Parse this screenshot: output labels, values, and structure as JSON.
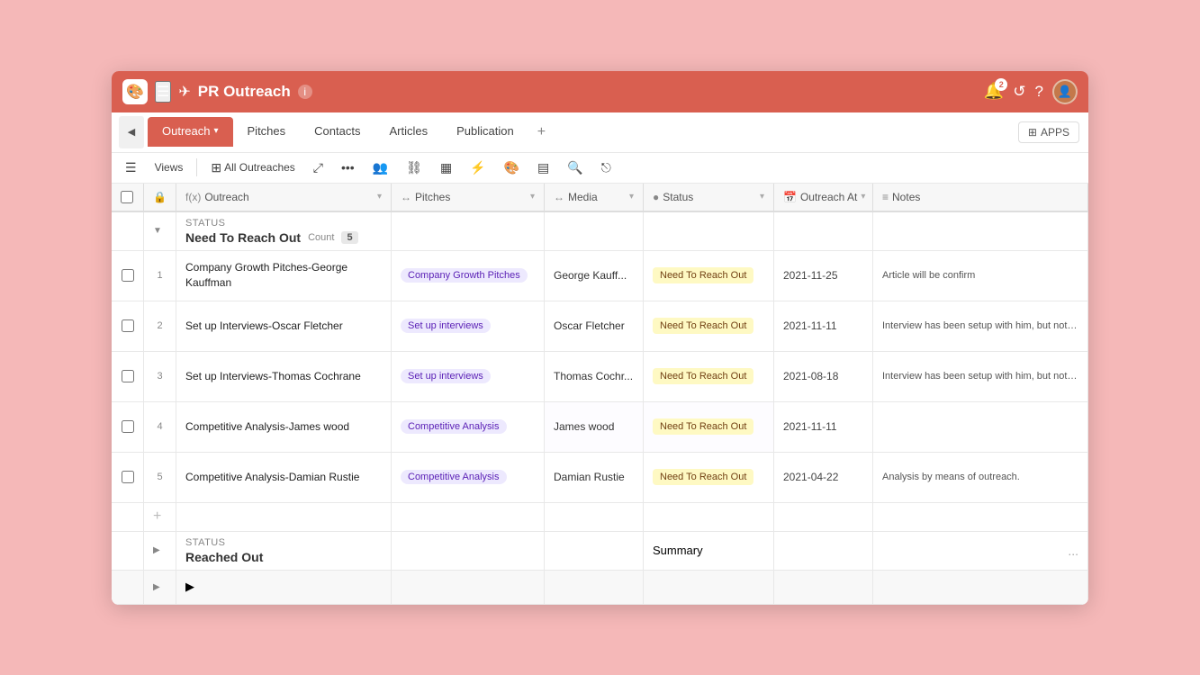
{
  "app": {
    "logo_emoji": "🎨",
    "title": "PR Outreach",
    "info_label": "ℹ",
    "notif_count": "2",
    "avatar_emoji": "👤"
  },
  "tabs": [
    {
      "id": "outreach",
      "label": "Outreach",
      "active": true
    },
    {
      "id": "pitches",
      "label": "Pitches",
      "active": false
    },
    {
      "id": "contacts",
      "label": "Contacts",
      "active": false
    },
    {
      "id": "articles",
      "label": "Articles",
      "active": false
    },
    {
      "id": "publication",
      "label": "Publication",
      "active": false
    }
  ],
  "toolbar": {
    "views_label": "Views",
    "alloutreaches_label": "All Outreaches"
  },
  "columns": [
    {
      "id": "outreach",
      "label": "Outreach",
      "icon": "fx"
    },
    {
      "id": "pitches",
      "label": "Pitches",
      "icon": "↔"
    },
    {
      "id": "media",
      "label": "Media",
      "icon": "↔"
    },
    {
      "id": "status",
      "label": "Status",
      "icon": "●"
    },
    {
      "id": "outreach_at",
      "label": "Outreach At",
      "icon": "📅"
    },
    {
      "id": "notes",
      "label": "Notes",
      "icon": "≡"
    }
  ],
  "groups": [
    {
      "id": "need-to-reach-out",
      "status_label": "STATUS",
      "title": "Need To Reach Out",
      "count_label": "Count",
      "count": "5",
      "rows": [
        {
          "num": "1",
          "outreach": "Company Growth Pitches-George Kauffman",
          "pitches": "Company Growth Pitches",
          "media": "George Kauff...",
          "status": "Need To Reach Out",
          "date": "2021-11-25",
          "notes": "Article will be confirm"
        },
        {
          "num": "2",
          "outreach": "Set up Interviews-Oscar Fletcher",
          "pitches": "Set up interviews",
          "media": "Oscar Fletcher",
          "status": "Need To Reach Out",
          "date": "2021-11-11",
          "notes": "Interview has been setup with him, but not a..."
        },
        {
          "num": "3",
          "outreach": "Set up Interviews-Thomas Cochrane",
          "pitches": "Set up interviews",
          "media": "Thomas Cochr...",
          "status": "Need To Reach Out",
          "date": "2021-08-18",
          "notes": "Interview has been setup with him, but not a..."
        },
        {
          "num": "4",
          "outreach": "Competitive Analysis-James wood",
          "pitches": "Competitive Analysis",
          "media": "James wood",
          "status": "Need To Reach Out",
          "date": "2021-11-11",
          "notes": ""
        },
        {
          "num": "5",
          "outreach": "Competitive Analysis-Damian Rustie",
          "pitches": "Competitive Analysis",
          "media": "Damian Rustie",
          "status": "Need To Reach Out",
          "date": "2021-04-22",
          "notes": "Analysis by means of outreach."
        }
      ]
    }
  ],
  "group2": {
    "status_label": "STATUS",
    "title": "Reached Out",
    "dots": "..."
  },
  "group3": {
    "icon": "▶"
  },
  "summary_label": "Summary"
}
